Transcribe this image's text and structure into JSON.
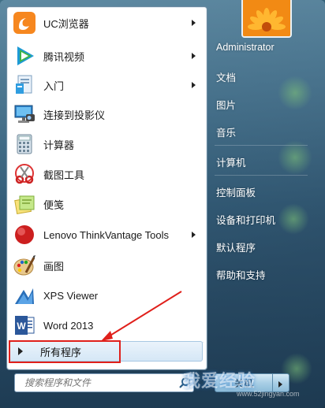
{
  "programs": [
    {
      "label": "UC浏览器",
      "icon": "uc-browser-icon",
      "has_submenu": true
    },
    {
      "label": "腾讯视频",
      "icon": "tencent-video-icon",
      "has_submenu": true
    },
    {
      "label": "入门",
      "icon": "getting-started-icon",
      "has_submenu": true
    },
    {
      "label": "连接到投影仪",
      "icon": "projector-icon",
      "has_submenu": false
    },
    {
      "label": "计算器",
      "icon": "calculator-icon",
      "has_submenu": false
    },
    {
      "label": "截图工具",
      "icon": "snipping-tool-icon",
      "has_submenu": false
    },
    {
      "label": "便笺",
      "icon": "sticky-notes-icon",
      "has_submenu": false
    },
    {
      "label": "Lenovo ThinkVantage Tools",
      "icon": "thinkvantage-icon",
      "has_submenu": true
    },
    {
      "label": "画图",
      "icon": "paint-icon",
      "has_submenu": false
    },
    {
      "label": "XPS Viewer",
      "icon": "xps-viewer-icon",
      "has_submenu": false
    },
    {
      "label": "Word 2013",
      "icon": "word-icon",
      "has_submenu": false
    }
  ],
  "all_programs": {
    "label": "所有程序"
  },
  "search": {
    "placeholder": "搜索程序和文件"
  },
  "right_pane": {
    "items": [
      "Administrator",
      "文档",
      "图片",
      "音乐",
      "计算机",
      "控制面板",
      "设备和打印机",
      "默认程序",
      "帮助和支持"
    ]
  },
  "shutdown": {
    "label": "关机"
  },
  "watermark": {
    "text": "我爱经验",
    "url": "www.52jingyan.com"
  },
  "colors": {
    "highlight": "#e0201b",
    "pane_bg": "#ffffff",
    "all_programs_bg": "#d5e7f6"
  }
}
